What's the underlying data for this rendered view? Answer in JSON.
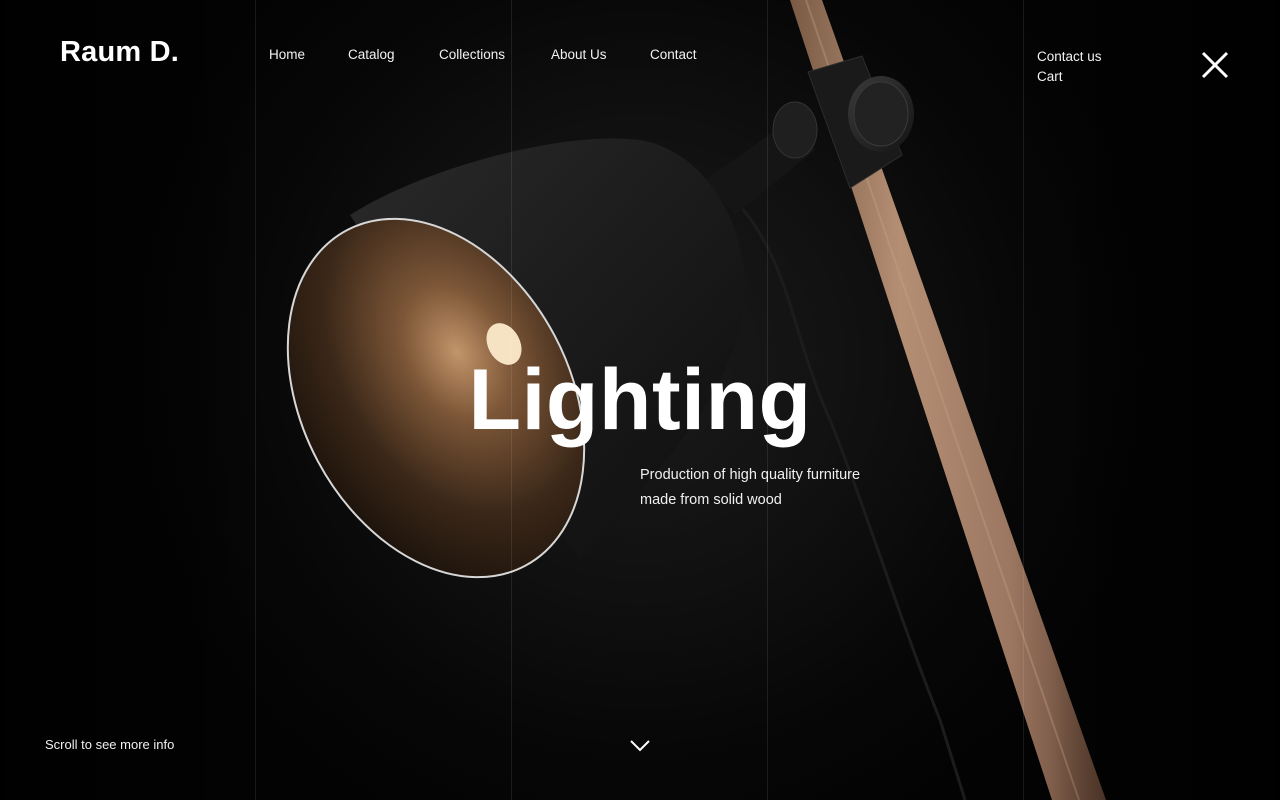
{
  "brand": {
    "logo_text": "Raum D."
  },
  "nav": {
    "items": [
      {
        "label": "Home"
      },
      {
        "label": "Catalog"
      },
      {
        "label": "Collections"
      },
      {
        "label": "About Us"
      },
      {
        "label": "Contact"
      }
    ]
  },
  "side_links": {
    "contact": "Contact us",
    "cart": "Cart"
  },
  "hero": {
    "title": "Lighting",
    "tagline_line1": "Production of high quality furniture",
    "tagline_line2": "made from solid wood"
  },
  "footer": {
    "scroll_hint": "Scroll to see more info"
  },
  "icons": {
    "close": "close-icon",
    "scroll": "chevron-down-icon"
  }
}
